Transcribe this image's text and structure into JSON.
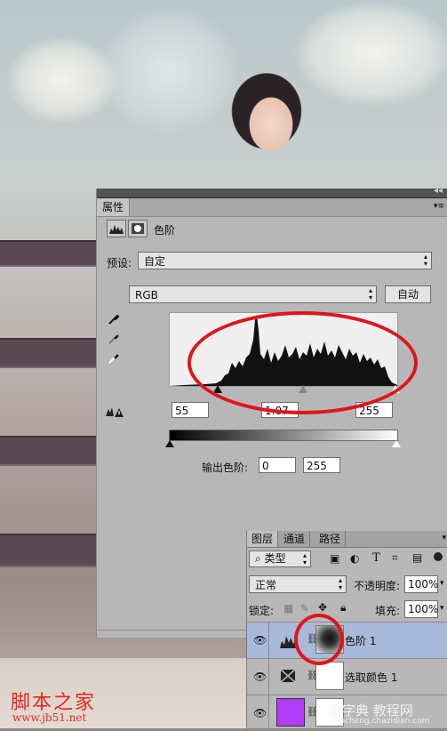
{
  "properties_panel": {
    "tab_label": "属性",
    "adjustment_title": "色阶",
    "preset_label": "预设:",
    "preset_value": "自定",
    "channel_value": "RGB",
    "auto_label": "自动",
    "input_black": "55",
    "input_gamma": "1.07",
    "input_white": "255",
    "output_label": "输出色阶:",
    "output_black": "0",
    "output_white": "255"
  },
  "layers_panel": {
    "tabs": [
      "图层",
      "通道",
      "路径"
    ],
    "filter_type": "类型",
    "blend_mode": "正常",
    "opacity_label": "不透明度:",
    "opacity_value": "100%",
    "lock_label": "锁定:",
    "fill_label": "填充:",
    "fill_value": "100%",
    "layers": [
      {
        "name": "色阶 1",
        "selected": true
      },
      {
        "name": "选取颜色 1",
        "selected": false
      },
      {
        "name": "",
        "selected": false
      }
    ]
  },
  "watermarks": {
    "left": "脚本之家",
    "left_url": "www.jb51.net",
    "right": "查字典 教程网",
    "right_url": "jiaocheng.chazidian.com"
  },
  "colors": {
    "annotation": "#e0141c",
    "selected_layer": "#a9b9d9",
    "color_fill_layer": "#b13cf5"
  }
}
